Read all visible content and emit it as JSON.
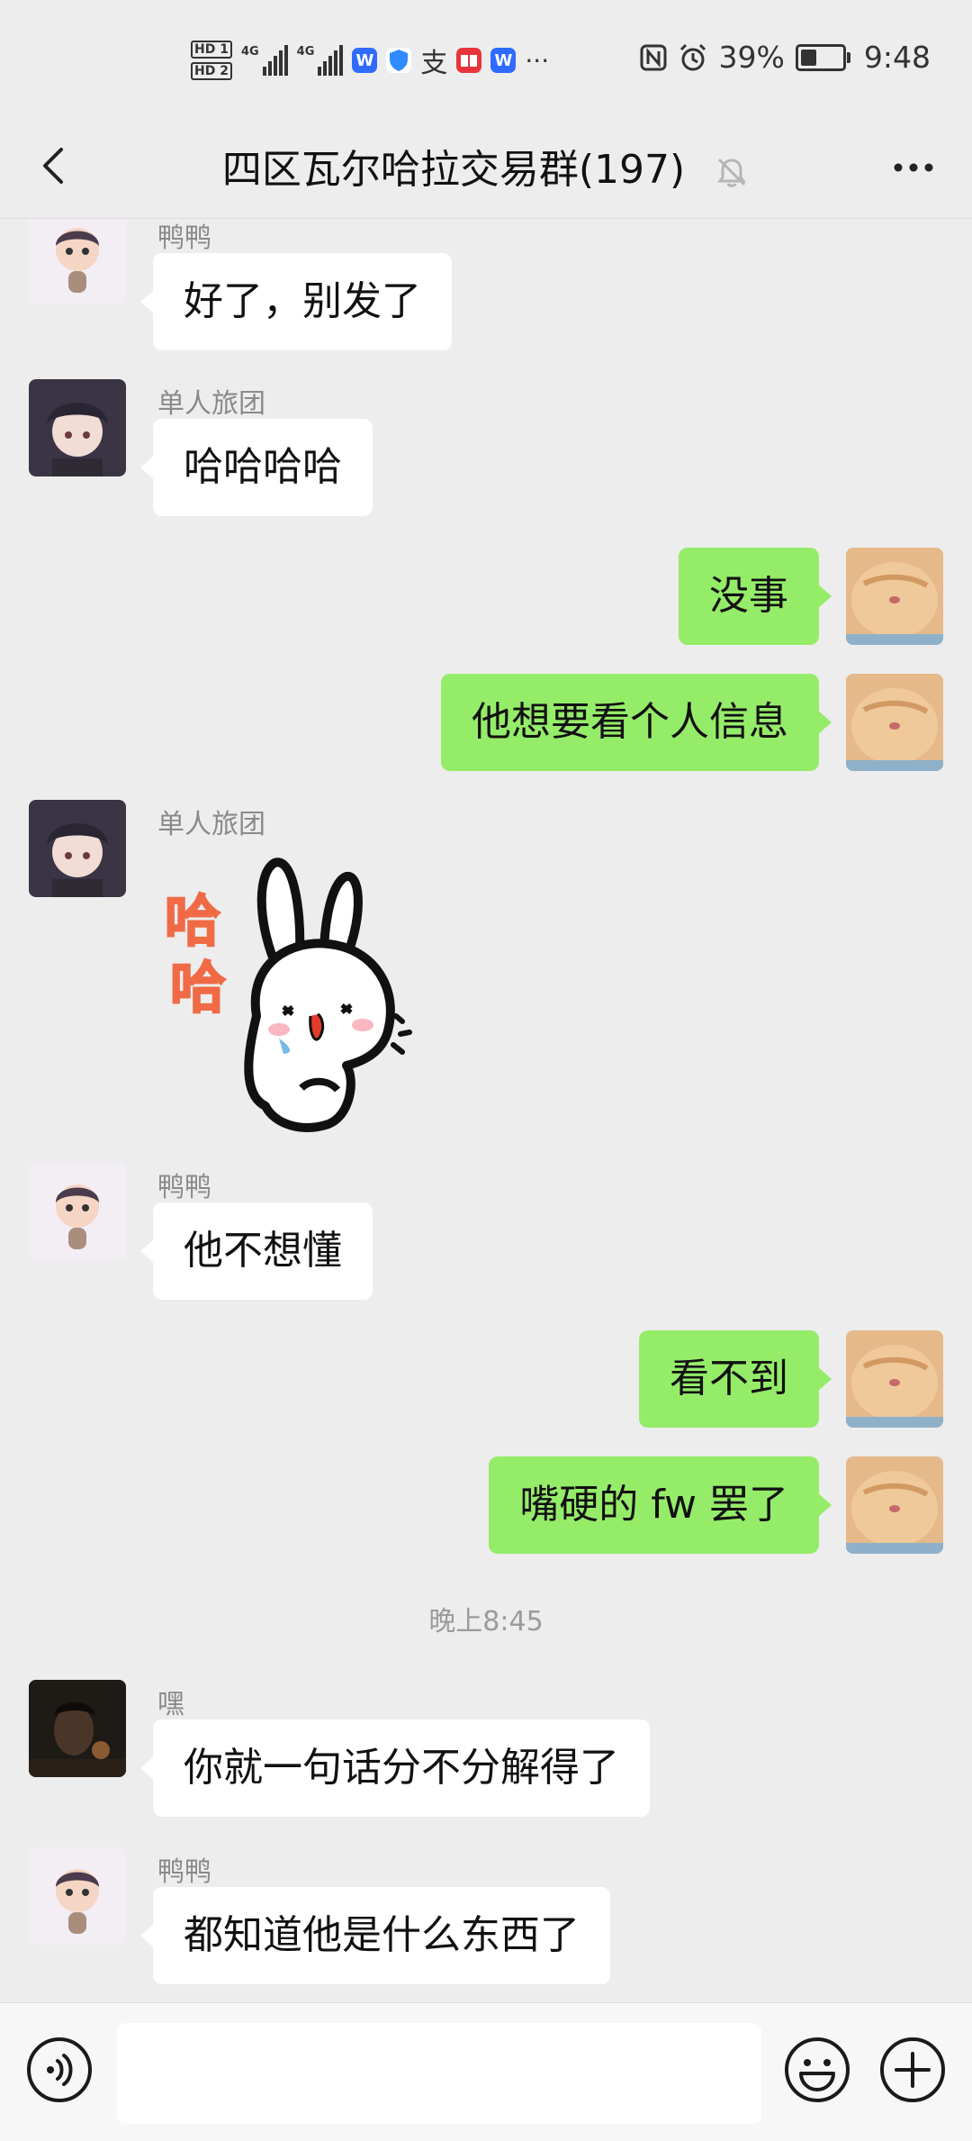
{
  "status_bar": {
    "hd_labels": [
      "HD 1",
      "HD 2"
    ],
    "net1": "4G",
    "net2": "4G",
    "app_icons": [
      "wps-icon",
      "shield-icon",
      "alipay-icon",
      "book-icon",
      "wps-icon"
    ],
    "overflow": "···",
    "nfc": "nfc-icon",
    "alarm": "alarm-icon",
    "battery_percent": "39%",
    "battery_level": 0.39,
    "time": "9:48"
  },
  "header": {
    "title": "四区瓦尔哈拉交易群(197)",
    "back_icon": "chevron-left-icon",
    "mute_icon": "bell-muted-icon",
    "more_icon": "more-dots-icon"
  },
  "messages": [
    {
      "side": "left",
      "sender": "鸭鸭",
      "text": "好了，别发了",
      "avatar": "duck-avatar"
    },
    {
      "side": "left",
      "sender": "单人旅团",
      "text": "哈哈哈哈",
      "avatar": "anime-avatar"
    },
    {
      "side": "right",
      "text": "没事",
      "avatar": "cat-avatar"
    },
    {
      "side": "right",
      "text": "他想要看个人信息",
      "avatar": "cat-avatar"
    },
    {
      "side": "left",
      "sender": "单人旅团",
      "sticker_text": "哈哈",
      "sticker": "rabbit-sticker",
      "avatar": "anime-avatar"
    },
    {
      "side": "left",
      "sender": "鸭鸭",
      "text": "他不想懂",
      "avatar": "duck-avatar"
    },
    {
      "side": "right",
      "text": "看不到",
      "avatar": "cat-avatar"
    },
    {
      "side": "right",
      "text": "嘴硬的 fw 罢了",
      "avatar": "cat-avatar"
    },
    {
      "timestamp": "晚上8:45"
    },
    {
      "side": "left",
      "sender": "嘿",
      "text": "你就一句话分不分解得了",
      "avatar": "dark-avatar"
    },
    {
      "side": "left",
      "sender": "鸭鸭",
      "text": "都知道他是什么东西了",
      "avatar": "duck-avatar"
    }
  ],
  "input_bar": {
    "voice_icon": "voice-icon",
    "input_value": "",
    "emoji_icon": "emoji-icon",
    "plus_icon": "plus-icon"
  },
  "colors": {
    "background": "#EDEDED",
    "self_bubble": "#95EC69",
    "other_bubble": "#FFFFFF",
    "sender_name": "#8A8A8A"
  }
}
